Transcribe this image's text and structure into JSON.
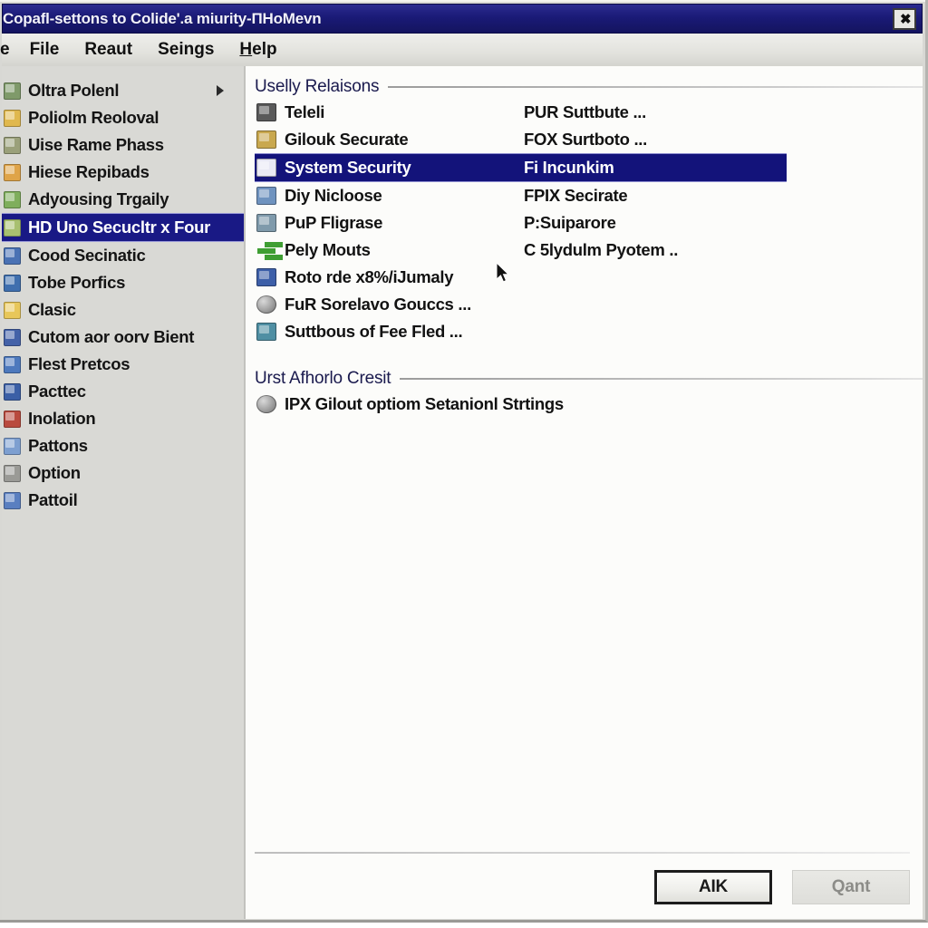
{
  "window": {
    "title": "Copafl-settons to Colide'.a miurity-ПHoMevn",
    "close_label": "✖"
  },
  "menubar": {
    "items": [
      {
        "label": "e",
        "clipped": true
      },
      {
        "label": "File"
      },
      {
        "label": "Reaut"
      },
      {
        "label": "Seings"
      },
      {
        "label": "Help",
        "mnemonic": "H"
      }
    ]
  },
  "sidebar": {
    "items": [
      {
        "label": "Oltra Polenl",
        "icon": "folder-green-icon",
        "color": "#7f9a6a",
        "submenu": true,
        "selected": false
      },
      {
        "label": "Poliolm Reoloval",
        "icon": "folder-yellow-icon",
        "color": "#e0b84e",
        "submenu": false,
        "selected": false
      },
      {
        "label": "Uise Rame Phass",
        "icon": "folder-olive-icon",
        "color": "#9aa07a",
        "submenu": false,
        "selected": false
      },
      {
        "label": "Hiese Repibads",
        "icon": "folder-orange-icon",
        "color": "#dfa448",
        "submenu": false,
        "selected": false
      },
      {
        "label": "Adyousing Trgaily",
        "icon": "leaf-green-icon",
        "color": "#7fae5c",
        "submenu": false,
        "selected": false
      },
      {
        "label": "HD Uno Secucltr x Four",
        "icon": "shield-green-icon",
        "color": "#a8c070",
        "submenu": false,
        "selected": true
      },
      {
        "label": "Cood Secinatic",
        "icon": "disc-blue-icon",
        "color": "#4a72b4",
        "submenu": false,
        "selected": false
      },
      {
        "label": "Tobe Porfics",
        "icon": "chart-blue-icon",
        "color": "#3f6fae",
        "submenu": false,
        "selected": false
      },
      {
        "label": "Clasic",
        "icon": "folder-gold-icon",
        "color": "#e8c75a",
        "submenu": false,
        "selected": false
      },
      {
        "label": "Cutom aor oorv Bient",
        "icon": "gear-blue-icon",
        "color": "#4462a8",
        "submenu": false,
        "selected": false
      },
      {
        "label": "Flest Pretcos",
        "icon": "globe-blue-icon",
        "color": "#4d79bd",
        "submenu": false,
        "selected": false
      },
      {
        "label": "Pacttec",
        "icon": "wave-blue-icon",
        "color": "#3b5fa6",
        "submenu": false,
        "selected": false
      },
      {
        "label": "Inolation",
        "icon": "circle-red-icon",
        "color": "#b94a3e",
        "submenu": false,
        "selected": false
      },
      {
        "label": "Pattons",
        "icon": "users-blue-icon",
        "color": "#7d9fd0",
        "submenu": false,
        "selected": false
      },
      {
        "label": "Option",
        "icon": "pen-gray-icon",
        "color": "#9a9a96",
        "submenu": false,
        "selected": false
      },
      {
        "label": "Pattoil",
        "icon": "book-blue-icon",
        "color": "#5a7fc0",
        "submenu": false,
        "selected": false
      }
    ]
  },
  "main": {
    "groups": [
      {
        "title": "Uselly Relaisons",
        "rows": [
          {
            "label": "Teleli",
            "value": "PUR Suttbute ...",
            "icon": "computer-icon",
            "color": "#5a5a5a",
            "shape": "box",
            "selected": false
          },
          {
            "label": "Gilouk Securate",
            "value": "FOX Surtboto ...",
            "icon": "user-shield-icon",
            "color": "#c9a84e",
            "shape": "box",
            "selected": false
          },
          {
            "label": "System Security",
            "value": "Fi Incunkim",
            "icon": "security-icon",
            "color": "#e8e8f4",
            "shape": "box",
            "selected": true
          },
          {
            "label": "Diy Nicloose",
            "value": "FPIX Secirate",
            "icon": "display-icon",
            "color": "#6f93bf",
            "shape": "box",
            "selected": false
          },
          {
            "label": "PuP Fligrase",
            "value": "P:Suiparore",
            "icon": "printer-icon",
            "color": "#7f9aab",
            "shape": "box",
            "selected": false
          },
          {
            "label": "Pely Mouts",
            "value": "C 5lydulm Pyotem ..",
            "icon": "add-plus-icon",
            "color": "#3f9e33",
            "shape": "plus",
            "selected": false
          },
          {
            "label": "Roto rde x8%/iJumaly",
            "value": "",
            "icon": "search-refresh-icon",
            "color": "#3d5fa8",
            "shape": "box",
            "selected": false
          },
          {
            "label": "FuR Sorelavo Gouccs ...",
            "value": "",
            "icon": "globe-gray-icon",
            "color": "#9e9e9e",
            "shape": "globe",
            "selected": false
          },
          {
            "label": "Suttbous of Fee Fled ...",
            "value": "",
            "icon": "document-icon",
            "color": "#4f8fa3",
            "shape": "box",
            "selected": false
          }
        ]
      },
      {
        "title": "Urst Afhorlo Cresit",
        "rows": [
          {
            "label": "IPX Gilout optiom Setanionl Strtings",
            "value": "",
            "icon": "network-globe-icon",
            "color": "#3f7fc4",
            "shape": "globe-blue",
            "selected": false,
            "wide": true
          }
        ]
      }
    ]
  },
  "footer": {
    "ok_label": "AIK",
    "cancel_label": "Qant"
  }
}
